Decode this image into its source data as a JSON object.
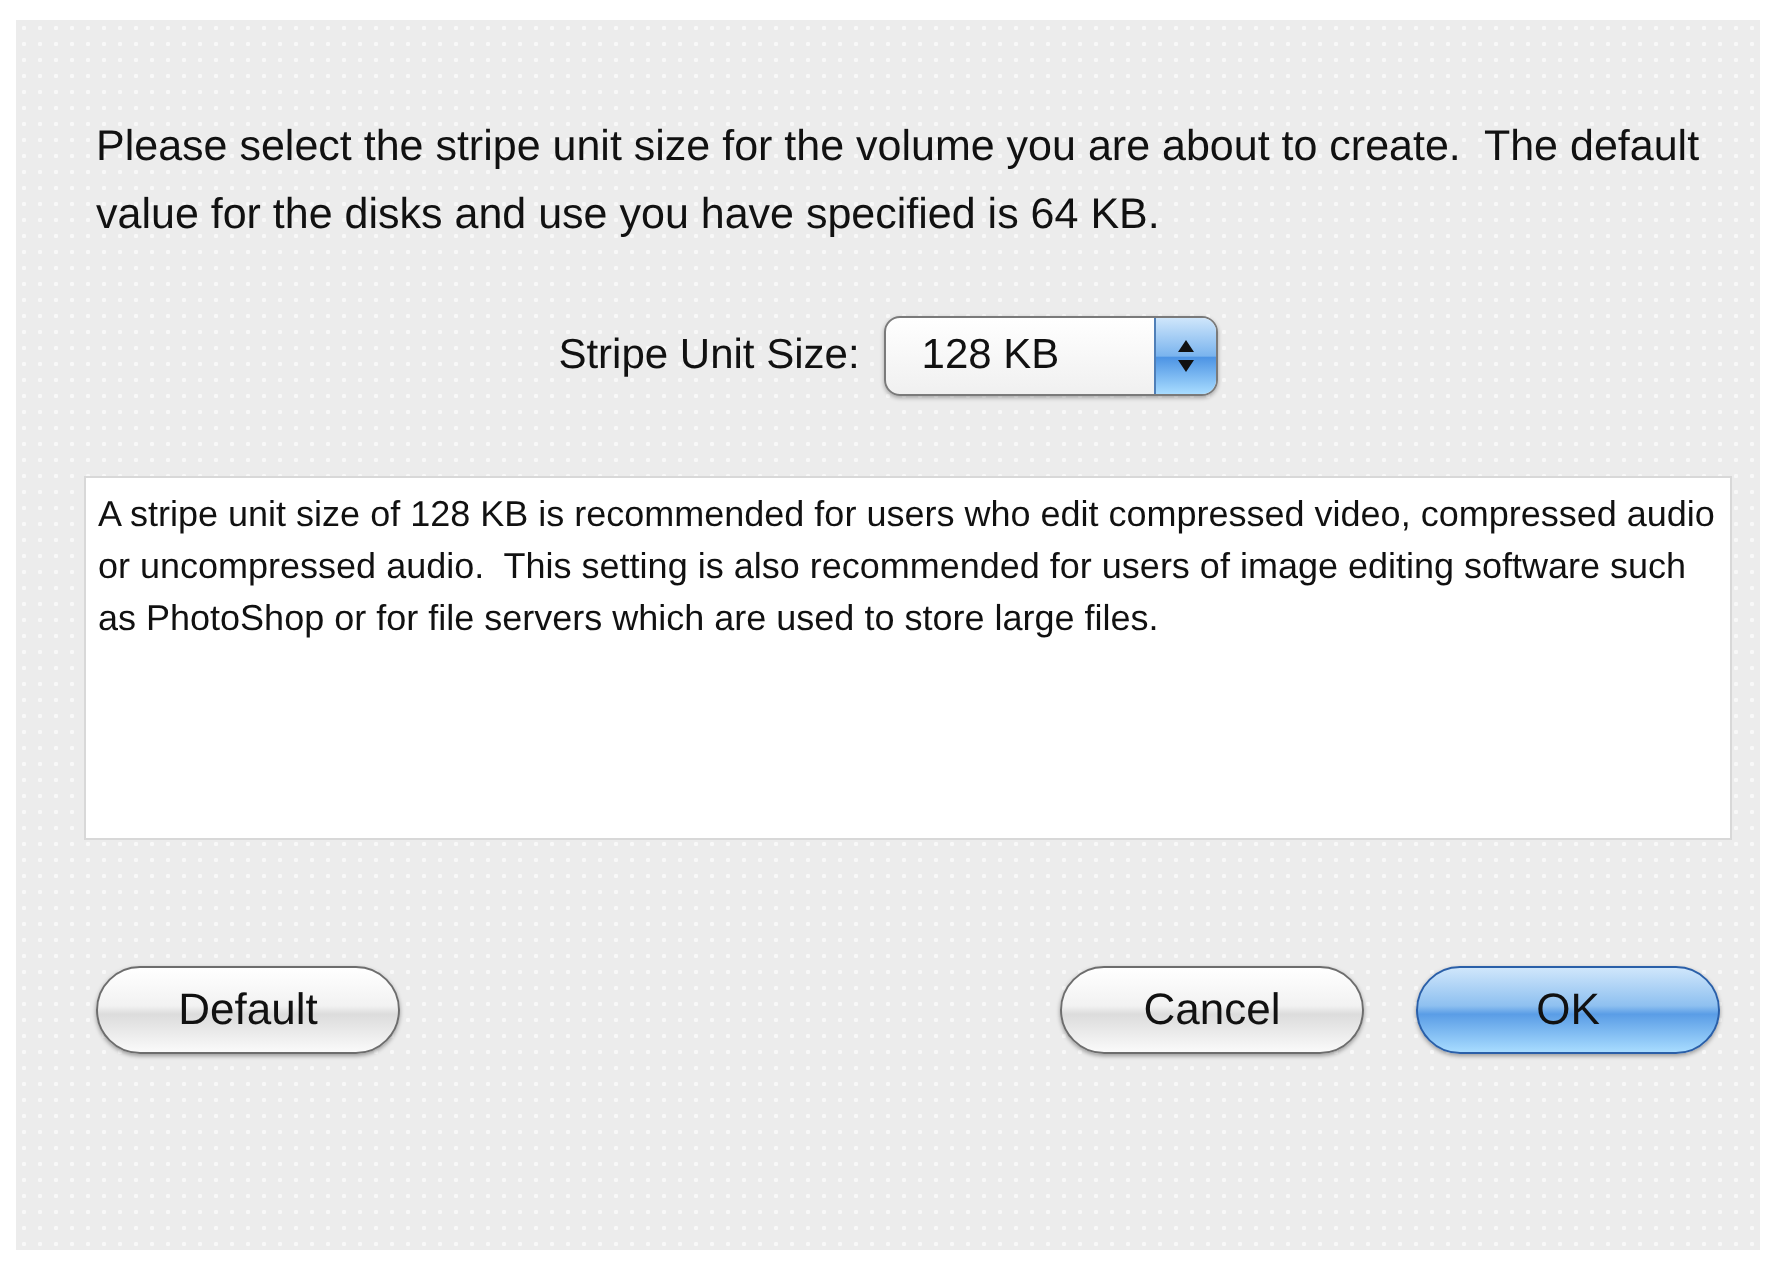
{
  "message": "Please select the stripe unit size for the volume you are about to create.  The default value for the disks and use you have specified is 64 KB.",
  "stripe_unit_size": {
    "label": "Stripe Unit Size:",
    "value": "128 KB"
  },
  "description": "A stripe unit size of 128 KB is recommended for users who edit compressed video, compressed audio or uncompressed audio.  This setting is also recommended for users of image editing software such as PhotoShop or for file servers which are used to store large files.",
  "buttons": [
    {
      "label": "Default",
      "kind": "plain"
    },
    {
      "label": "Cancel",
      "kind": "plain"
    },
    {
      "label": "OK",
      "kind": "primary"
    }
  ]
}
